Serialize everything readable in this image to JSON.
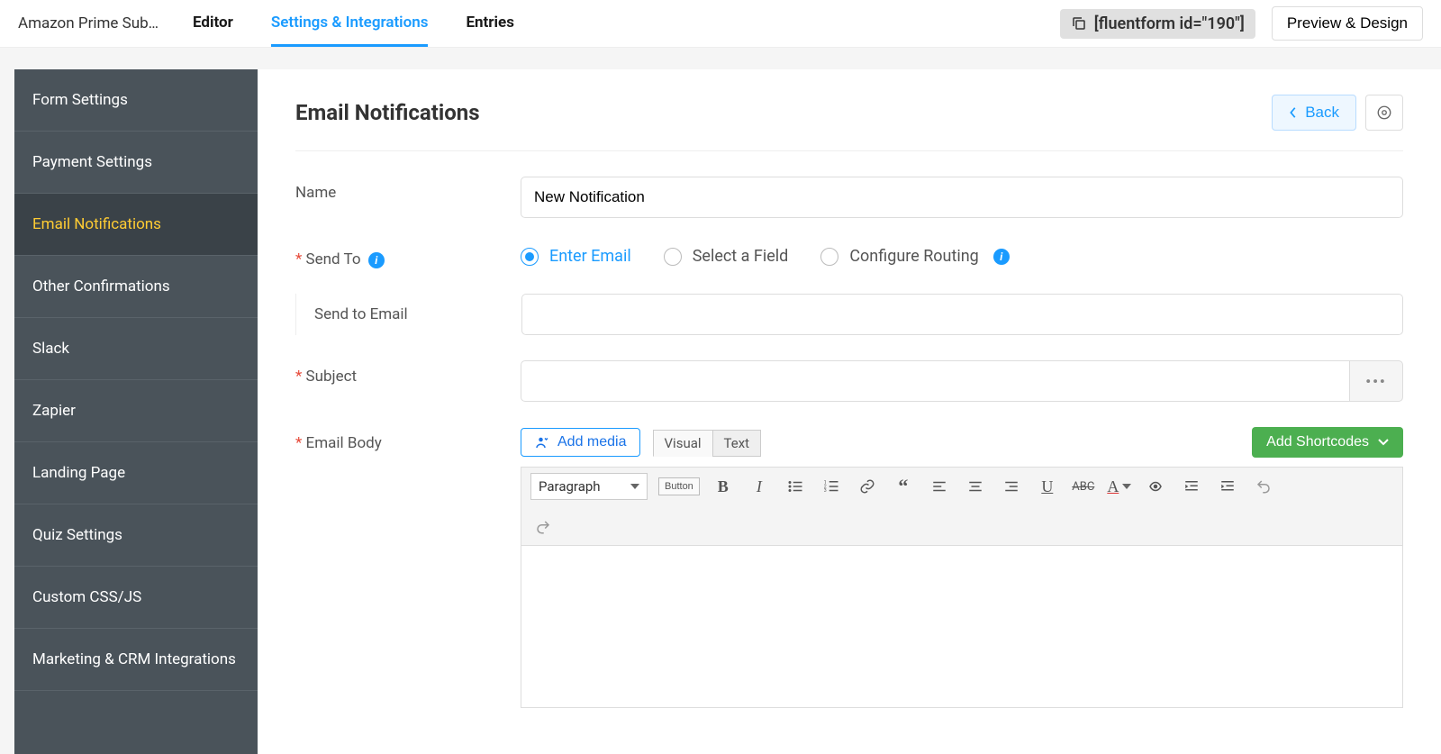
{
  "top": {
    "form_name": "Amazon Prime Sub…",
    "tabs": [
      "Editor",
      "Settings & Integrations",
      "Entries"
    ],
    "active_tab": 1,
    "shortcode": "[fluentform id=\"190\"]",
    "preview_label": "Preview & Design"
  },
  "sidebar": {
    "items": [
      "Form Settings",
      "Payment Settings",
      "Email Notifications",
      "Other Confirmations",
      "Slack",
      "Zapier",
      "Landing Page",
      "Quiz Settings",
      "Custom CSS/JS",
      "Marketing & CRM Integrations"
    ],
    "active_index": 2
  },
  "header": {
    "title": "Email Notifications",
    "back_label": "Back"
  },
  "fields": {
    "name_label": "Name",
    "name_value": "New Notification",
    "send_to_label": "Send To",
    "send_to_options": [
      "Enter Email",
      "Select a Field",
      "Configure Routing"
    ],
    "send_to_selected": 0,
    "send_to_email_label": "Send to Email",
    "send_to_email_value": "",
    "subject_label": "Subject",
    "subject_value": "",
    "body_label": "Email Body"
  },
  "editor": {
    "add_media_label": "Add media",
    "tabs": [
      "Visual",
      "Text"
    ],
    "active_tab": 0,
    "add_shortcodes_label": "Add Shortcodes",
    "format": "Paragraph",
    "button_label": "Button"
  }
}
